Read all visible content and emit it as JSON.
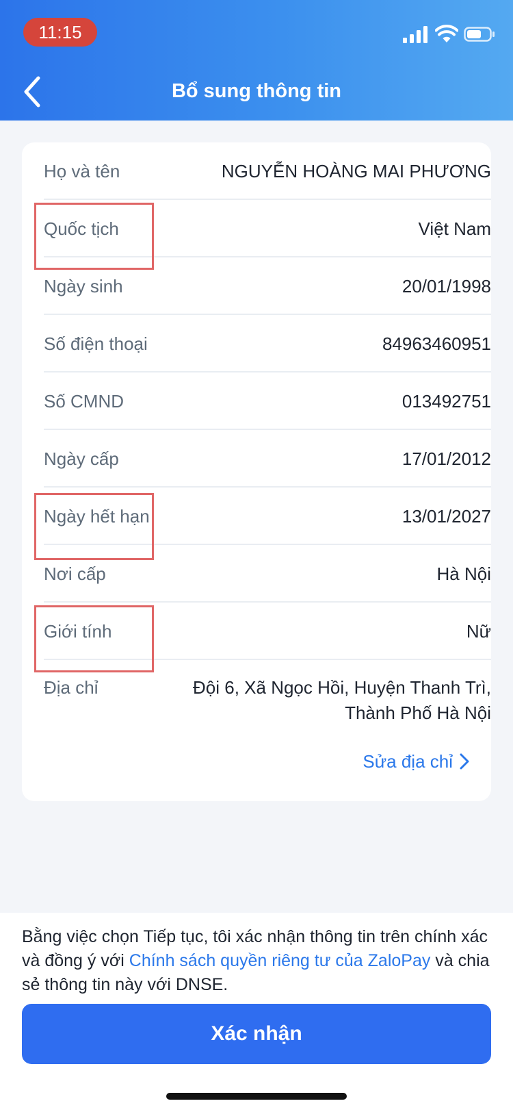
{
  "status_bar": {
    "time": "11:15",
    "icons": [
      "signal-icon",
      "wifi-icon",
      "battery-icon"
    ]
  },
  "header": {
    "back_icon": "chevron-left-icon",
    "title": "Bổ sung thông tin"
  },
  "info": {
    "rows": [
      {
        "label": "Họ và tên",
        "value": "NGUYỄN HOÀNG MAI PHƯƠNG"
      },
      {
        "label": "Quốc tịch",
        "value": "Việt Nam"
      },
      {
        "label": "Ngày sinh",
        "value": "20/01/1998"
      },
      {
        "label": "Số điện thoại",
        "value": "84963460951"
      },
      {
        "label": "Số CMND",
        "value": "013492751"
      },
      {
        "label": "Ngày cấp",
        "value": "17/01/2012"
      },
      {
        "label": "Ngày hết hạn",
        "value": "13/01/2027"
      },
      {
        "label": "Nơi cấp",
        "value": "Hà Nội"
      },
      {
        "label": "Giới tính",
        "value": "Nữ"
      },
      {
        "label": "Địa chỉ",
        "value": "Đội 6, Xã Ngọc Hồi, Huyện Thanh Trì, Thành Phố Hà Nội"
      }
    ],
    "edit_address_label": "Sửa địa chỉ"
  },
  "footer": {
    "consent_before": "Bằng việc chọn Tiếp tục, tôi xác nhận thông tin trên chính xác và đồng ý với ",
    "consent_link": "Chính sách quyền riêng tư của ZaloPay",
    "consent_after": " và chia sẻ thông tin này với DNSE.",
    "confirm_label": "Xác nhận"
  },
  "colors": {
    "header_gradient_start": "#2c74ea",
    "header_gradient_end": "#54a9f1",
    "primary": "#2f6df0",
    "link": "#2b78ea",
    "highlight": "#e06666",
    "time_pill": "#d5453b"
  }
}
